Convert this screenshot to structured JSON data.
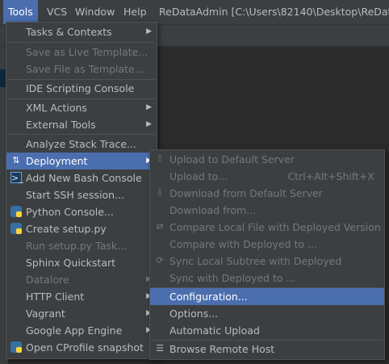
{
  "menubar": {
    "items": [
      "Tools",
      "VCS",
      "Window",
      "Help"
    ],
    "title": "ReDataAdmin [C:\\Users\\82140\\Desktop\\ReDataA"
  },
  "tools_menu": {
    "tasks": "Tasks & Contexts",
    "save_live": "Save as Live Template...",
    "save_file": "Save File as Template...",
    "ide_console": "IDE Scripting Console",
    "xml_actions": "XML Actions",
    "external_tools": "External Tools",
    "analyze_stack": "Analyze Stack Trace...",
    "deployment": "Deployment",
    "bash_console": "Add New Bash Console",
    "ssh_session": "Start SSH session...",
    "python_console": "Python Console...",
    "create_setup": "Create setup.py",
    "run_setup": "Run setup.py Task...",
    "sphinx": "Sphinx Quickstart",
    "datalore": "Datalore",
    "http_client": "HTTP Client",
    "vagrant": "Vagrant",
    "gae": "Google App Engine",
    "cprofile": "Open CProfile snapshot"
  },
  "deployment_menu": {
    "upload_default": "Upload to Default Server",
    "upload_to": "Upload to...",
    "upload_to_shortcut": "Ctrl+Alt+Shift+X",
    "download_default": "Download from Default Server",
    "download_from": "Download from...",
    "compare_local": "Compare Local File with Deployed Version",
    "compare_deployed": "Compare with Deployed to ...",
    "sync_subtree": "Sync Local Subtree with Deployed",
    "sync_with": "Sync with Deployed to ...",
    "configuration": "Configuration...",
    "options": "Options...",
    "auto_upload": "Automatic Upload",
    "browse_remote": "Browse Remote Host"
  },
  "colors": {
    "highlight": "#4b6eaf",
    "menu_bg": "#3c3f41",
    "text": "#bbbbbb",
    "disabled": "#777777"
  }
}
